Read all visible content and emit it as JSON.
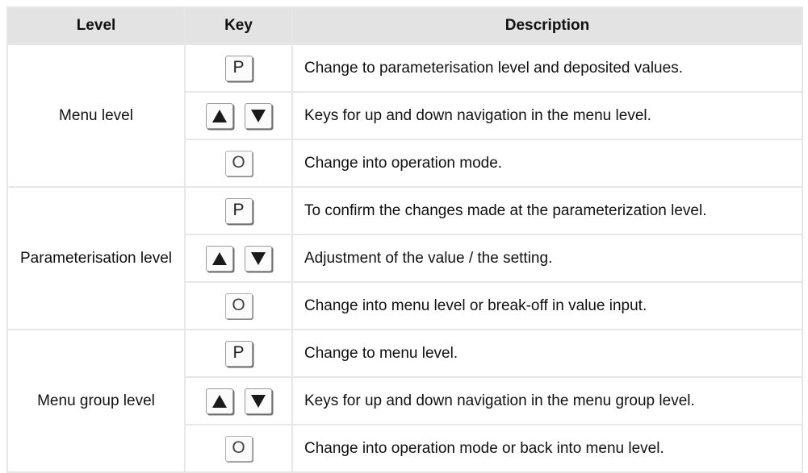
{
  "headers": {
    "level": "Level",
    "key": "Key",
    "description": "Description"
  },
  "groups": [
    {
      "level": "Menu level",
      "rows": [
        {
          "key": "P",
          "description": "Change to parameterisation level and deposited values."
        },
        {
          "key": "up-down",
          "description": "Keys for up and down navigation in the menu level."
        },
        {
          "key": "O",
          "description": "Change into operation mode."
        }
      ]
    },
    {
      "level": "Parameterisation level",
      "rows": [
        {
          "key": "P",
          "description": "To confirm the changes made at the parameterization level."
        },
        {
          "key": "up-down",
          "description": "Adjustment of the value / the setting."
        },
        {
          "key": "O",
          "description": "Change into menu level or break-off in value input."
        }
      ]
    },
    {
      "level": "Menu group level",
      "rows": [
        {
          "key": "P",
          "description": "Change to menu level."
        },
        {
          "key": "up-down",
          "description": "Keys for up and down navigation in the menu group level."
        },
        {
          "key": "O",
          "description": "Change into operation mode or back into menu level."
        }
      ]
    }
  ],
  "keys": {
    "p_label": "P",
    "o_label": "O",
    "up_icon": "up-triangle-icon",
    "down_icon": "down-triangle-icon"
  },
  "colors": {
    "header_bg": "#e3e3e3",
    "border": "#e7e7e7",
    "text": "#111111",
    "key_border": "#9a9a9a",
    "triangle": "#1a1a1a"
  }
}
